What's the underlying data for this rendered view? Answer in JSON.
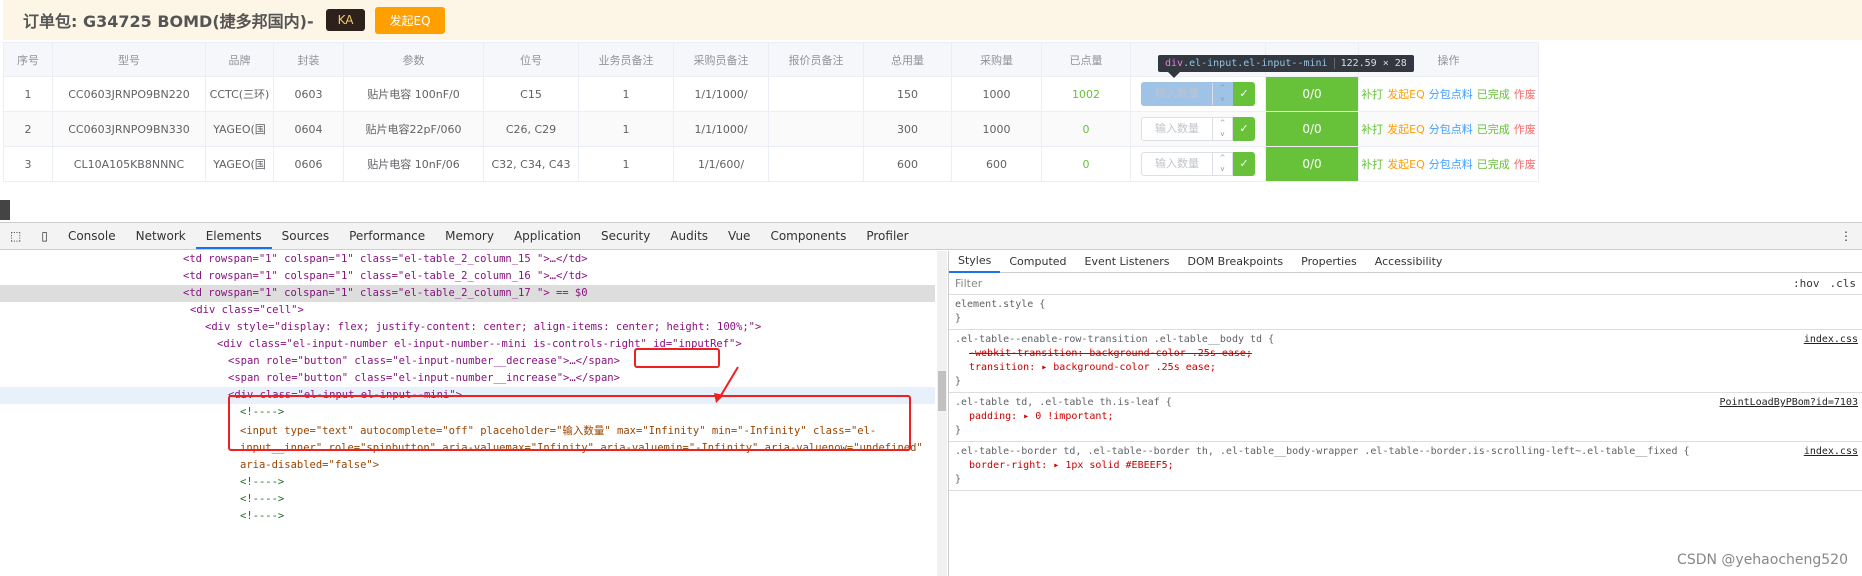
{
  "header": {
    "title": "订单包: G34725 BOMD(捷多邦国内)-",
    "ka_label": "KA",
    "eq_label": "发起EQ"
  },
  "table": {
    "columns": [
      "序号",
      "型号",
      "品牌",
      "封装",
      "参数",
      "位号",
      "业务员备注",
      "采购员备注",
      "报价员备注",
      "总用量",
      "采购量",
      "已点量",
      "",
      "",
      "操作"
    ],
    "rows": [
      {
        "no": "1",
        "model": "CC0603JRNPO9BN220",
        "brand": "CCTC(三环)",
        "pkg": "0603",
        "param": "贴片电容 100nF/0",
        "ref": "C15",
        "sales": "1",
        "buyer": "1/1/1000/",
        "quote": "",
        "total": "150",
        "purchase": "1000",
        "counted": "1002",
        "progress": "0/0"
      },
      {
        "no": "2",
        "model": "CC0603JRNPO9BN330",
        "brand": "YAGEO(国",
        "pkg": "0604",
        "param": "贴片电容22pF/060",
        "ref": "C26, C29",
        "sales": "1",
        "buyer": "1/1/1000/",
        "quote": "",
        "total": "300",
        "purchase": "1000",
        "counted": "0",
        "progress": "0/0"
      },
      {
        "no": "3",
        "model": "CL10A105KB8NNNC",
        "brand": "YAGEO(国",
        "pkg": "0606",
        "param": "贴片电容 10nF/06",
        "ref": "C32, C34, C43",
        "sales": "1",
        "buyer": "1/1/600/",
        "quote": "",
        "total": "600",
        "purchase": "600",
        "counted": "0",
        "progress": "0/0"
      }
    ],
    "input_placeholder": "输入数量",
    "actions": [
      "补打",
      "发起EQ",
      "分包点料",
      "已完成",
      "作废"
    ],
    "action_colors": [
      "#67c23a",
      "#ff9f00",
      "#409eff",
      "#67c23a",
      "#f56c6c"
    ]
  },
  "tooltip": {
    "tag": "div",
    "cls": ".el-input.el-input--mini",
    "size": "122.59 × 28"
  },
  "devtools": {
    "tabs": [
      "Console",
      "Network",
      "Elements",
      "Sources",
      "Performance",
      "Memory",
      "Application",
      "Security",
      "Audits",
      "Vue",
      "Components",
      "Profiler"
    ],
    "active_tab": "Elements",
    "lines": [
      "<td rowspan=\"1\" colspan=\"1\" class=\"el-table_2_column_15  \">…</td>",
      "<td rowspan=\"1\" colspan=\"1\" class=\"el-table_2_column_16  \">…</td>",
      "<td rowspan=\"1\" colspan=\"1\" class=\"el-table_2_column_17  \"> == $0",
      "<div class=\"cell\">",
      "<div style=\"display: flex; justify-content: center; align-items: center; height: 100%;\">",
      "<div class=\"el-input-number el-input-number--mini is-controls-right\" id=\"inputRef\">",
      "<span role=\"button\" class=\"el-input-number__decrease\">…</span>",
      "<span role=\"button\" class=\"el-input-number__increase\">…</span>",
      "<div class=\"el-input el-input--mini\">",
      "<!---->",
      "<input type=\"text\" autocomplete=\"off\" placeholder=\"输入数量\" max=\"Infinity\" min=\"-Infinity\" class=\"el-",
      "input__inner\" role=\"spinbutton\" aria-valuemax=\"Infinity\" aria-valuemin=\"-Infinity\" aria-valuenow=\"undefined\"",
      "aria-disabled=\"false\">",
      "<!---->",
      "<!---->",
      "<!---->"
    ],
    "styles_tabs": [
      "Styles",
      "Computed",
      "Event Listeners",
      "DOM Breakpoints",
      "Properties",
      "Accessibility"
    ],
    "filter_placeholder": "Filter",
    "hov": ":hov",
    "cls": ".cls",
    "rules": [
      {
        "selector": "element.style {",
        "props": [],
        "src": ""
      },
      {
        "selector": ".el-table--enable-row-transition .el-table__body td {",
        "props": [
          "-webkit-transition: background-color .25s ease;",
          "transition: ▸ background-color .25s ease;"
        ],
        "src": "index.css"
      },
      {
        "selector": ".el-table td, .el-table th.is-leaf {",
        "props": [
          "padding: ▸ 0 !important;"
        ],
        "src": "PointLoadByPBom?id=7103"
      },
      {
        "selector": ".el-table--border td, .el-table--border th, .el-table__body-wrapper .el-table--border.is-scrolling-left~.el-table__fixed {",
        "props": [
          "border-right: ▸ 1px solid #EBEEF5;"
        ],
        "src": "index.css"
      }
    ]
  },
  "watermark": "CSDN @yehaocheng520"
}
